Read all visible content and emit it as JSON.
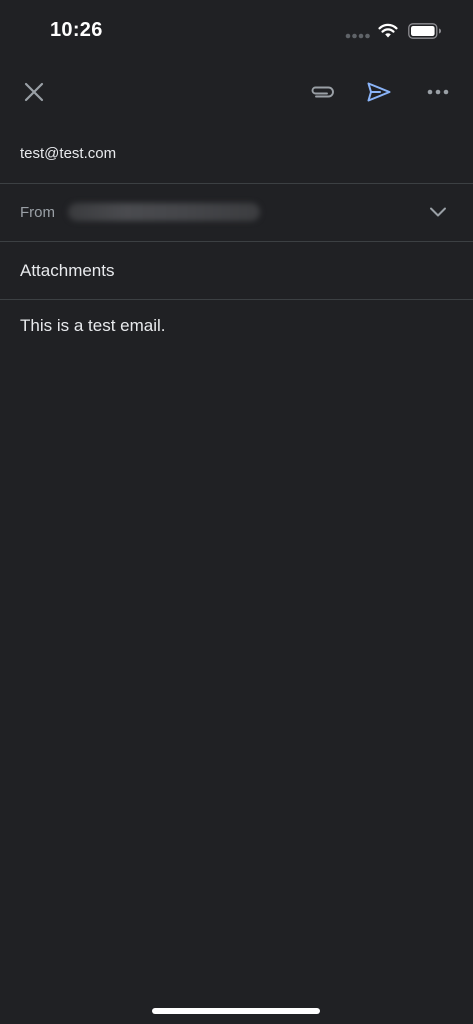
{
  "status_bar": {
    "time": "10:26"
  },
  "toolbar": {
    "close_icon": "close-icon",
    "attach_icon": "paperclip-icon",
    "send_icon": "send-icon",
    "more_icon": "more-horizontal-icon",
    "send_color": "#8ab4f8"
  },
  "compose": {
    "to": "test@test.com",
    "from_label": "From",
    "attachments_label": "Attachments",
    "body": "This is a test email."
  }
}
